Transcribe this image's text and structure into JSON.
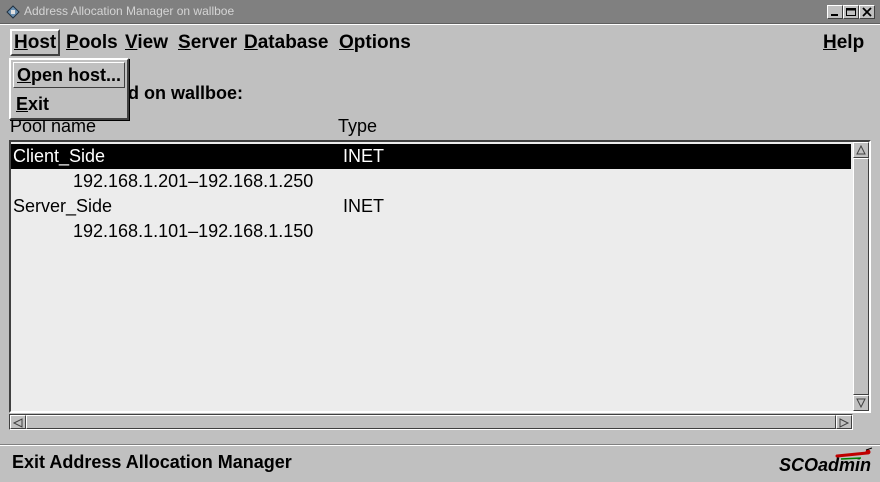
{
  "window": {
    "title": "Address Allocation Manager on wallboe"
  },
  "menubar": {
    "items": [
      {
        "label": "Host",
        "mnemonic": "H"
      },
      {
        "label": "Pools",
        "mnemonic": "P"
      },
      {
        "label": "View",
        "mnemonic": "V"
      },
      {
        "label": "Server",
        "mnemonic": "S"
      },
      {
        "label": "Database",
        "mnemonic": "D"
      },
      {
        "label": "Options",
        "mnemonic": "O"
      },
      {
        "label": "Help",
        "mnemonic": "H"
      }
    ],
    "active": "Host"
  },
  "host_menu": {
    "items": [
      {
        "label": "Open host...",
        "mnemonic": "O"
      },
      {
        "label": "Exit",
        "mnemonic": "E"
      }
    ]
  },
  "main": {
    "heading_visible": "d on wallboe:",
    "columns": {
      "name": "Pool name",
      "type": "Type"
    },
    "pools": [
      {
        "name": "Client_Side",
        "type": "INET",
        "range": "192.168.1.201–192.168.1.250",
        "selected": true
      },
      {
        "name": "Server_Side",
        "type": "INET",
        "range": "192.168.1.101–192.168.1.150",
        "selected": false
      }
    ]
  },
  "status": {
    "text": "Exit Address Allocation Manager"
  },
  "brand": {
    "sco": "SCO",
    "admin": "admin"
  }
}
